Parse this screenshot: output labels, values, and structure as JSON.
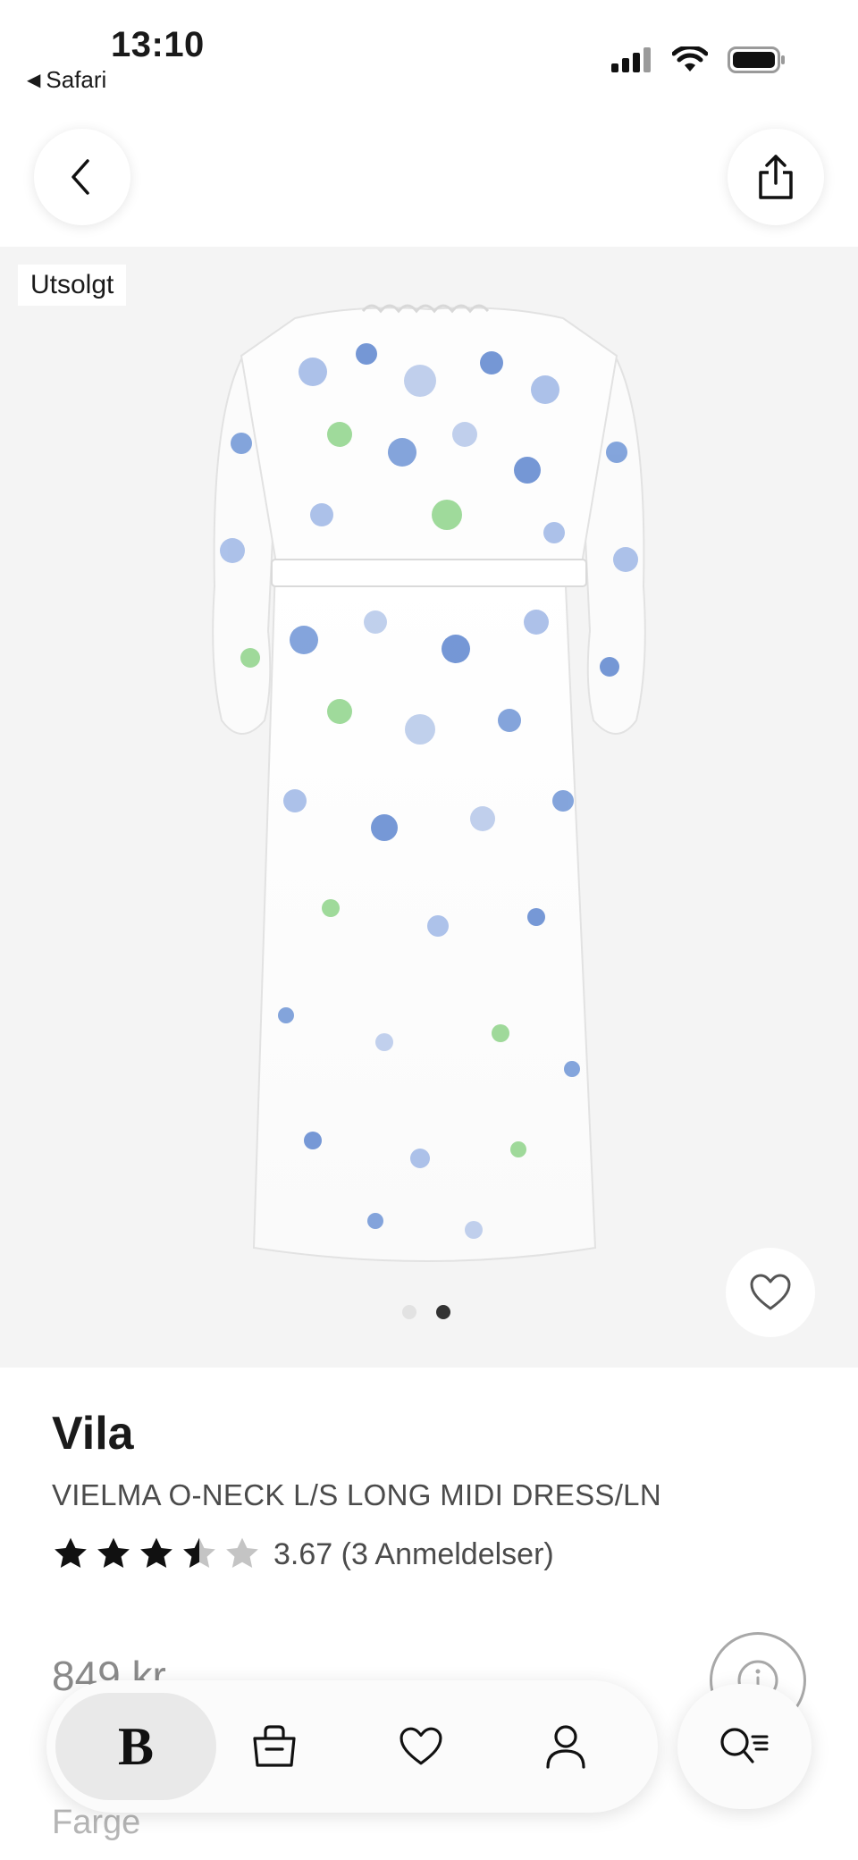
{
  "status_bar": {
    "time": "13:10",
    "back_app_label": "Safari",
    "icons": [
      "signal-icon",
      "wifi-icon",
      "battery-icon"
    ]
  },
  "header": {
    "icons": [
      "chevron-left-icon",
      "share-icon"
    ]
  },
  "gallery": {
    "badge": "Utsolgt",
    "image_count": 2,
    "active_image": 2,
    "favorite_icon": "heart-icon"
  },
  "product": {
    "brand": "Vila",
    "name": "VIELMA O-NECK L/S LONG MIDI DRESS/LN",
    "rating_value": 3.67,
    "rating_text": "3.67 (3 Anmeldelser)",
    "stars_max": 5,
    "price": "849 kr",
    "color_label": "Farge"
  },
  "bottom_nav": {
    "items": [
      {
        "name": "home",
        "label": "B",
        "icon": "brand-logo-icon",
        "active": true
      },
      {
        "name": "bag",
        "icon": "shopping-bag-icon",
        "active": false
      },
      {
        "name": "favorites",
        "icon": "heart-icon",
        "active": false
      },
      {
        "name": "account",
        "icon": "person-icon",
        "active": false
      }
    ],
    "search_icon": "search-icon"
  },
  "colors": {
    "background": "#ffffff",
    "gallery_background": "#f4f4f4",
    "text_primary": "#1a1a1a",
    "text_secondary": "#4b4b4b",
    "star_filled": "#111111",
    "star_empty": "#c4c4c4"
  }
}
